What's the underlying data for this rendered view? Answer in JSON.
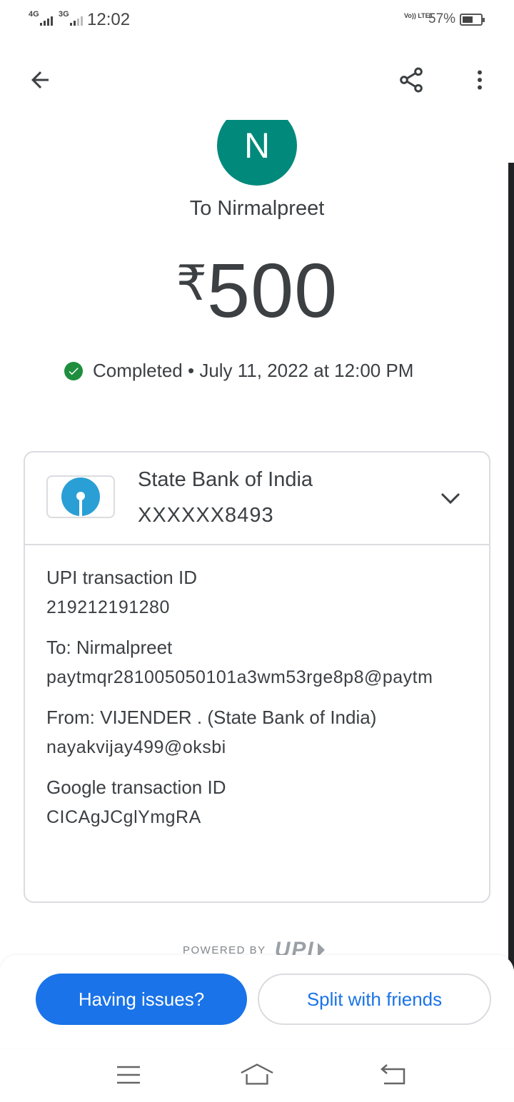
{
  "status_bar": {
    "net1": "4G",
    "net2": "3G",
    "time": "12:02",
    "volte": "Vo)) LTE1",
    "battery": "57%",
    "battery_level": 0.57
  },
  "toolbar": {
    "back_icon": "arrow-back-icon",
    "share_icon": "share-icon",
    "more_icon": "more-vert-icon"
  },
  "payment": {
    "avatar_initial": "N",
    "recipient": "To Nirmalpreet",
    "currency": "₹",
    "amount": "500",
    "status": "Completed",
    "separator": "•",
    "date": "July 11, 2022 at 12:00 PM"
  },
  "bank": {
    "name": "State Bank of India",
    "account": "XXXXXX8493"
  },
  "details": {
    "upi_label": "UPI transaction ID",
    "upi_value": "219212191280",
    "to_label": "To: Nirmalpreet",
    "to_value": "paytmqr281005050101a3wm53rge8p8@paytm",
    "from_label": "From: VIJENDER  . (State Bank of India)",
    "from_value": "nayakvijay499@oksbi",
    "google_label": "Google transaction ID",
    "google_value": "CICAgJCglYmgRA"
  },
  "footer": {
    "powered_by": "POWERED BY",
    "upi_logo": "UPI",
    "issues_button": "Having issues?",
    "split_button": "Split with friends"
  },
  "colors": {
    "avatar": "#01897b",
    "primary": "#1a73e8",
    "success": "#1e8e3e"
  }
}
